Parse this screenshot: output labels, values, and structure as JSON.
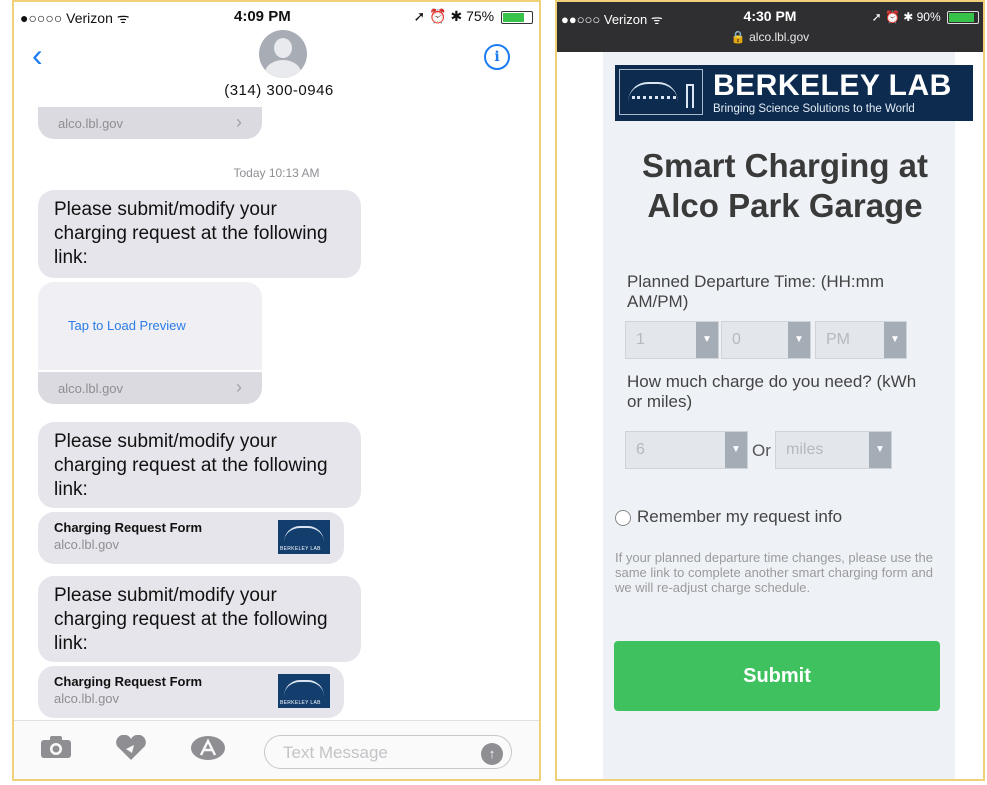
{
  "left_phone": {
    "status": {
      "carrier": "●○○○○ Verizon ᯤ",
      "time": "4:09 PM",
      "battery": "75%",
      "battery_level": 0.75,
      "indicators": "➚ ⏰ ✱"
    },
    "header": {
      "contact_number": "(314) 300-0946",
      "info_icon": "i",
      "back_icon": "‹"
    },
    "thread": {
      "top_link_domain": "alco.lbl.gov",
      "timestamp": "Today 10:13 AM",
      "messages": [
        {
          "text": "Please submit/modify your charging request at the following link:",
          "preview_label": "Tap to Load Preview",
          "link_domain": "alco.lbl.gov"
        },
        {
          "text": "Please submit/modify your charging request at the following link:",
          "card_title": "Charging Request Form",
          "card_domain": "alco.lbl.gov"
        },
        {
          "text": "Please submit/modify your charging request at the following link:",
          "card_title": "Charging Request Form",
          "card_domain": "alco.lbl.gov"
        }
      ],
      "card_logo_text": "BERKELEY LAB",
      "chevron": "›"
    },
    "input_bar": {
      "placeholder": "Text Message",
      "send_icon": "↑",
      "icons": [
        "camera-icon",
        "digital-touch-icon",
        "app-store-icon"
      ]
    }
  },
  "right_phone": {
    "status": {
      "carrier": "●●○○○ Verizon ᯤ",
      "time": "4:30 PM",
      "url": "🔒 alco.lbl.gov",
      "battery": "90%",
      "battery_level": 0.9,
      "indicators": "➚ ⏰ ✱"
    },
    "banner": {
      "name": "BERKELEY LAB",
      "tagline": "Bringing Science Solutions to the World"
    },
    "form": {
      "title": "Smart Charging at Alco Park Garage",
      "departure_label": "Planned Departure Time: (HH:mm AM/PM)",
      "hour_value": "1",
      "minute_value": "0",
      "ampm_value": "PM",
      "charge_label": "How much charge do you need? (kWh or miles)",
      "charge_value": "6",
      "or_label": "Or",
      "unit_value": "miles",
      "remember_label": "Remember my request info",
      "notice": "If your planned departure time changes, please use the same link to complete another smart charging form and we will re-adjust charge schedule.",
      "submit_label": "Submit",
      "dropdown_arrow": "▼"
    }
  },
  "colors": {
    "ios_blue": "#1d7cf2",
    "bubble_gray": "#e6e5eb",
    "lab_navy": "#0c2b4f",
    "submit_green": "#3fc160",
    "frame_border": "#f1d07a"
  }
}
